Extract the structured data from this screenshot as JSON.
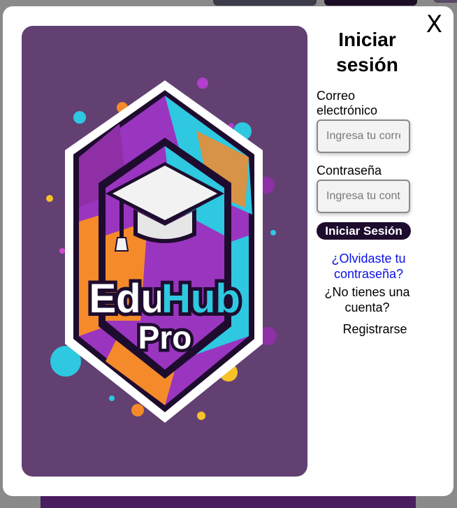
{
  "modal": {
    "close_label": "X"
  },
  "logo": {
    "brand_word_1": "Edu",
    "brand_word_2": "Hub",
    "brand_word_3": "Pro"
  },
  "login": {
    "title_line1": "Iniciar",
    "title_line2": "sesión",
    "email_label": "Correo electrónico",
    "email_placeholder": "Ingresa tu correo",
    "email_value": "",
    "password_label": "Contraseña",
    "password_placeholder": "Ingresa tu contraseña",
    "password_value": "",
    "submit_label": "Iniciar Sesión",
    "forgot_link": "¿Olvidaste tu contraseña?",
    "no_account_text": "¿No tienes una cuenta?",
    "register_link": "Registrarse"
  },
  "colors": {
    "artwork_background": "#624072",
    "submit_button": "#1e0c2e",
    "link": "#0b12e6",
    "brand_cyan": "#2ec8e0",
    "brand_purple": "#8e2fa6",
    "brand_orange": "#f58a2a"
  }
}
